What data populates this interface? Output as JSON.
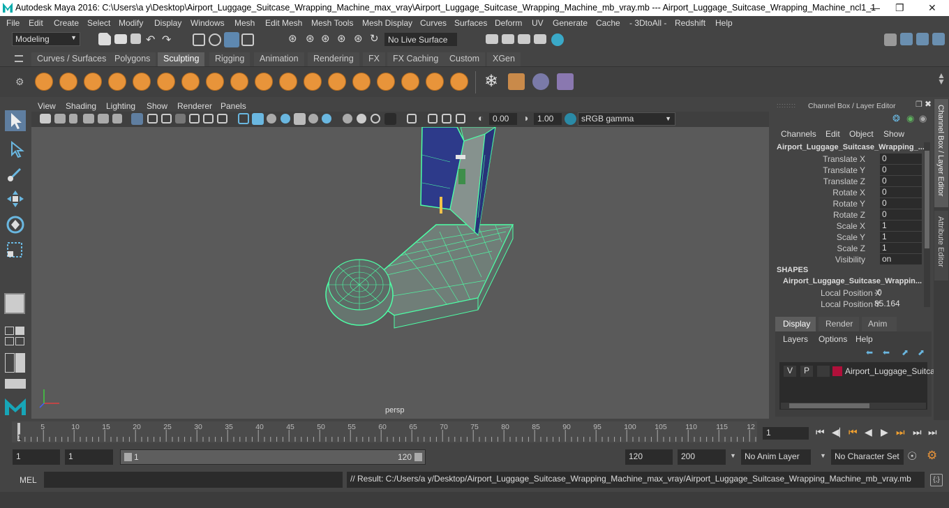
{
  "window": {
    "title": "Autodesk Maya 2016: C:\\Users\\a y\\Desktop\\Airport_Luggage_Suitcase_Wrapping_Machine_max_vray\\Airport_Luggage_Suitcase_Wrapping_Machine_mb_vray.mb   ---   Airport_Luggage_Suitcase_Wrapping_Machine_ncl1_1"
  },
  "menu": [
    "File",
    "Edit",
    "Create",
    "Select",
    "Modify",
    "Display",
    "Windows",
    "Mesh",
    "Edit Mesh",
    "Mesh Tools",
    "Mesh Display",
    "Curves",
    "Surfaces",
    "Deform",
    "UV",
    "Generate",
    "Cache",
    "- 3DtoAll -",
    "Redshift",
    "Help"
  ],
  "status": {
    "mode": "Modeling",
    "live_surface": "No Live Surface"
  },
  "shelf_tabs": [
    "Curves / Surfaces",
    "Polygons",
    "Sculpting",
    "Rigging",
    "Animation",
    "Rendering",
    "FX",
    "FX Caching",
    "Custom",
    "XGen"
  ],
  "shelf_active": "Sculpting",
  "viewport": {
    "menu": [
      "View",
      "Shading",
      "Lighting",
      "Show",
      "Renderer",
      "Panels"
    ],
    "exposure": "0.00",
    "gamma": "1.00",
    "color_space": "sRGB gamma",
    "camera_label": "persp"
  },
  "channel_box": {
    "header": "Channel Box / Layer Editor",
    "menu": [
      "Channels",
      "Edit",
      "Object",
      "Show"
    ],
    "object_name": "Airport_Luggage_Suitcase_Wrapping_...",
    "attributes": [
      {
        "label": "Translate X",
        "value": "0"
      },
      {
        "label": "Translate Y",
        "value": "0"
      },
      {
        "label": "Translate Z",
        "value": "0"
      },
      {
        "label": "Rotate X",
        "value": "0"
      },
      {
        "label": "Rotate Y",
        "value": "0"
      },
      {
        "label": "Rotate Z",
        "value": "0"
      },
      {
        "label": "Scale X",
        "value": "1"
      },
      {
        "label": "Scale Y",
        "value": "1"
      },
      {
        "label": "Scale Z",
        "value": "1"
      },
      {
        "label": "Visibility",
        "value": "on"
      }
    ],
    "shapes_label": "SHAPES",
    "shape_name": "Airport_Luggage_Suitcase_Wrappin...",
    "shape_attributes": [
      {
        "label": "Local Position X",
        "value": "-0"
      },
      {
        "label": "Local Position Y",
        "value": "85.164"
      }
    ]
  },
  "layer_editor": {
    "tabs": [
      "Display",
      "Render",
      "Anim"
    ],
    "active_tab": "Display",
    "menu": [
      "Layers",
      "Options",
      "Help"
    ],
    "layer": {
      "v": "V",
      "p": "P",
      "name": "Airport_Luggage_Suitcas",
      "color": "#b0103a"
    }
  },
  "side_tabs": [
    "Channel Box / Layer Editor",
    "Attribute Editor"
  ],
  "timeline": {
    "ticks": [
      "5",
      "10",
      "15",
      "20",
      "25",
      "30",
      "35",
      "40",
      "45",
      "50",
      "55",
      "60",
      "65",
      "70",
      "75",
      "80",
      "85",
      "90",
      "95",
      "100",
      "105",
      "110",
      "115",
      "12"
    ],
    "start_mark": "1",
    "current_frame": "1"
  },
  "range": {
    "start": "1",
    "playback_start": "1",
    "slider_start": "1",
    "slider_end": "120",
    "playback_end": "120",
    "end": "200",
    "anim_layer": "No Anim Layer",
    "character_set": "No Character Set"
  },
  "command": {
    "lang": "MEL",
    "result": "// Result: C:/Users/a y/Desktop/Airport_Luggage_Suitcase_Wrapping_Machine_max_vray/Airport_Luggage_Suitcase_Wrapping_Machine_mb_vray.mb"
  },
  "colors": {
    "accent": "#5d5d5d",
    "wire": "#4dffa6",
    "sculpt": "#e8943a"
  }
}
